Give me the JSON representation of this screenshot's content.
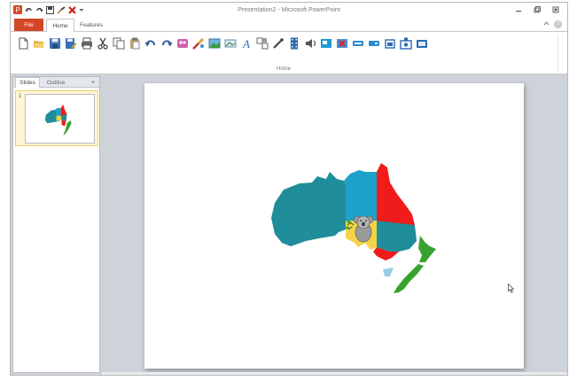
{
  "window": {
    "title": "Presentation2 - Microsoft PowerPoint"
  },
  "quick_access": {
    "icons": [
      "app-logo-icon",
      "undo-icon",
      "redo-icon",
      "save-icon",
      "brush-icon",
      "close-red-icon",
      "customize-dropdown-icon"
    ]
  },
  "tabs": {
    "file": "File",
    "home": "Home",
    "features": "Features"
  },
  "ribbon": {
    "group_label": "Home",
    "tools": [
      "new-icon",
      "open-icon",
      "save-icon",
      "save-as-icon",
      "print-icon",
      "cut-icon",
      "copy-icon",
      "paste-icon",
      "undo-icon",
      "redo-icon",
      "clip-art-icon",
      "format-painter-icon",
      "picture-icon",
      "image-icon",
      "text-icon",
      "shapes-icon",
      "pen-icon",
      "film-strip-icon",
      "sound-icon",
      "slide-icon",
      "delete-slide-icon",
      "view-icon",
      "view-alt-icon",
      "slideshow-icon",
      "presenter-icon",
      "window-icon"
    ]
  },
  "slides_pane": {
    "tab_slides": "Slides",
    "tab_outline": "Outline",
    "close_glyph": "×",
    "slide_number": "1"
  },
  "colors": {
    "file_tab": "#d24726",
    "teal": "#1f8d9a",
    "blue": "#1ea1c9",
    "red": "#f01b1b",
    "yellow": "#f5d348",
    "green": "#37a22e",
    "light_blue": "#97cde8"
  }
}
